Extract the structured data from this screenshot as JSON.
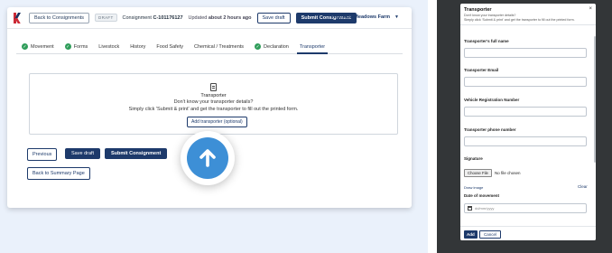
{
  "left": {
    "header": {
      "back_label": "Back to Consignments",
      "status_badge": "DRAFT",
      "consignment_prefix": "Consignment",
      "consignment_id": "C-101176127",
      "updated_prefix": "Updated",
      "updated_time": "about 2 hours ago",
      "save_draft_label": "Save draft",
      "submit_label": "Submit Consignment",
      "farm_name": "Highland Meadows Farm"
    },
    "tabs": [
      {
        "label": "Movement",
        "complete": true
      },
      {
        "label": "Forms",
        "complete": true
      },
      {
        "label": "Livestock",
        "complete": false
      },
      {
        "label": "History",
        "complete": false
      },
      {
        "label": "Food Safety",
        "complete": false
      },
      {
        "label": "Chemical / Treatments",
        "complete": false
      },
      {
        "label": "Declaration",
        "complete": true
      },
      {
        "label": "Transporter",
        "complete": false,
        "active": true
      }
    ],
    "transporter_card": {
      "title": "Transporter",
      "subtitle": "Don't know your transporter details?",
      "description": "Simply click 'Submit & print' and get the transporter to fill out the printed form.",
      "add_button": "Add transporter (optional)"
    },
    "footer": {
      "previous": "Previous",
      "save_draft": "Save draft",
      "submit": "Submit Consignment",
      "back_summary": "Back to Summary Page"
    }
  },
  "modal": {
    "title": "Transporter",
    "close_glyph": "×",
    "subtitle_line1": "Don't know your transporter details?",
    "subtitle_line2": "Simply click 'Submit & print' and get the transporter to fill out the printed form.",
    "fields": {
      "full_name_label": "Transporter's full name",
      "email_label": "Transporter Email",
      "rego_label": "Vehicle Registration Number",
      "phone_label": "Transporter phone number",
      "signature_label": "Signature",
      "choose_file": "Choose File",
      "no_file": "No file chosen",
      "draw_image": "Draw image",
      "clear": "Clear",
      "date_label": "Date of movement",
      "date_placeholder": "dd/mm/yyyy"
    },
    "add_label": "Add",
    "cancel_label": "Cancel"
  },
  "colors": {
    "primary": "#1d3a6b",
    "accent_blue": "#3d8fd6",
    "complete_green": "#2f9d5a",
    "page_bg": "#eaf1fb",
    "overlay": "#333638"
  },
  "icons": {
    "logo": "k-logo-icon",
    "upload": "up-arrow-icon",
    "tab_complete": "check-circle-icon",
    "document": "document-icon",
    "calendar": "calendar-icon"
  }
}
